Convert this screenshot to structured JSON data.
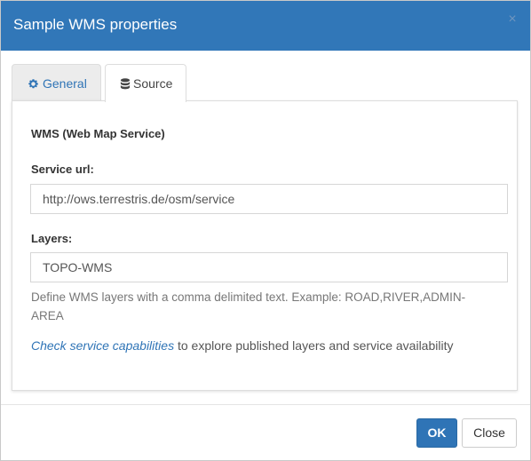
{
  "dialog": {
    "title": "Sample WMS properties",
    "close_glyph": "×"
  },
  "tabs": [
    {
      "label": "General",
      "icon": "gear-icon",
      "active": false
    },
    {
      "label": "Source",
      "icon": "database-icon",
      "active": true
    }
  ],
  "source": {
    "section_title": "WMS (Web Map Service)",
    "service_url_label": "Service url:",
    "service_url_value": "http://ows.terrestris.de/osm/service",
    "layers_label": "Layers:",
    "layers_value": "TOPO-WMS",
    "layers_help": "Define WMS layers with a comma delimited text. Example: ROAD,RIVER,ADMIN-AREA",
    "capabilities_link": "Check service capabilities",
    "capabilities_text": " to explore published layers and service availability"
  },
  "footer": {
    "ok_label": "OK",
    "close_label": "Close"
  },
  "colors": {
    "header_bg": "#3177b8",
    "accent": "#2f74b6"
  }
}
